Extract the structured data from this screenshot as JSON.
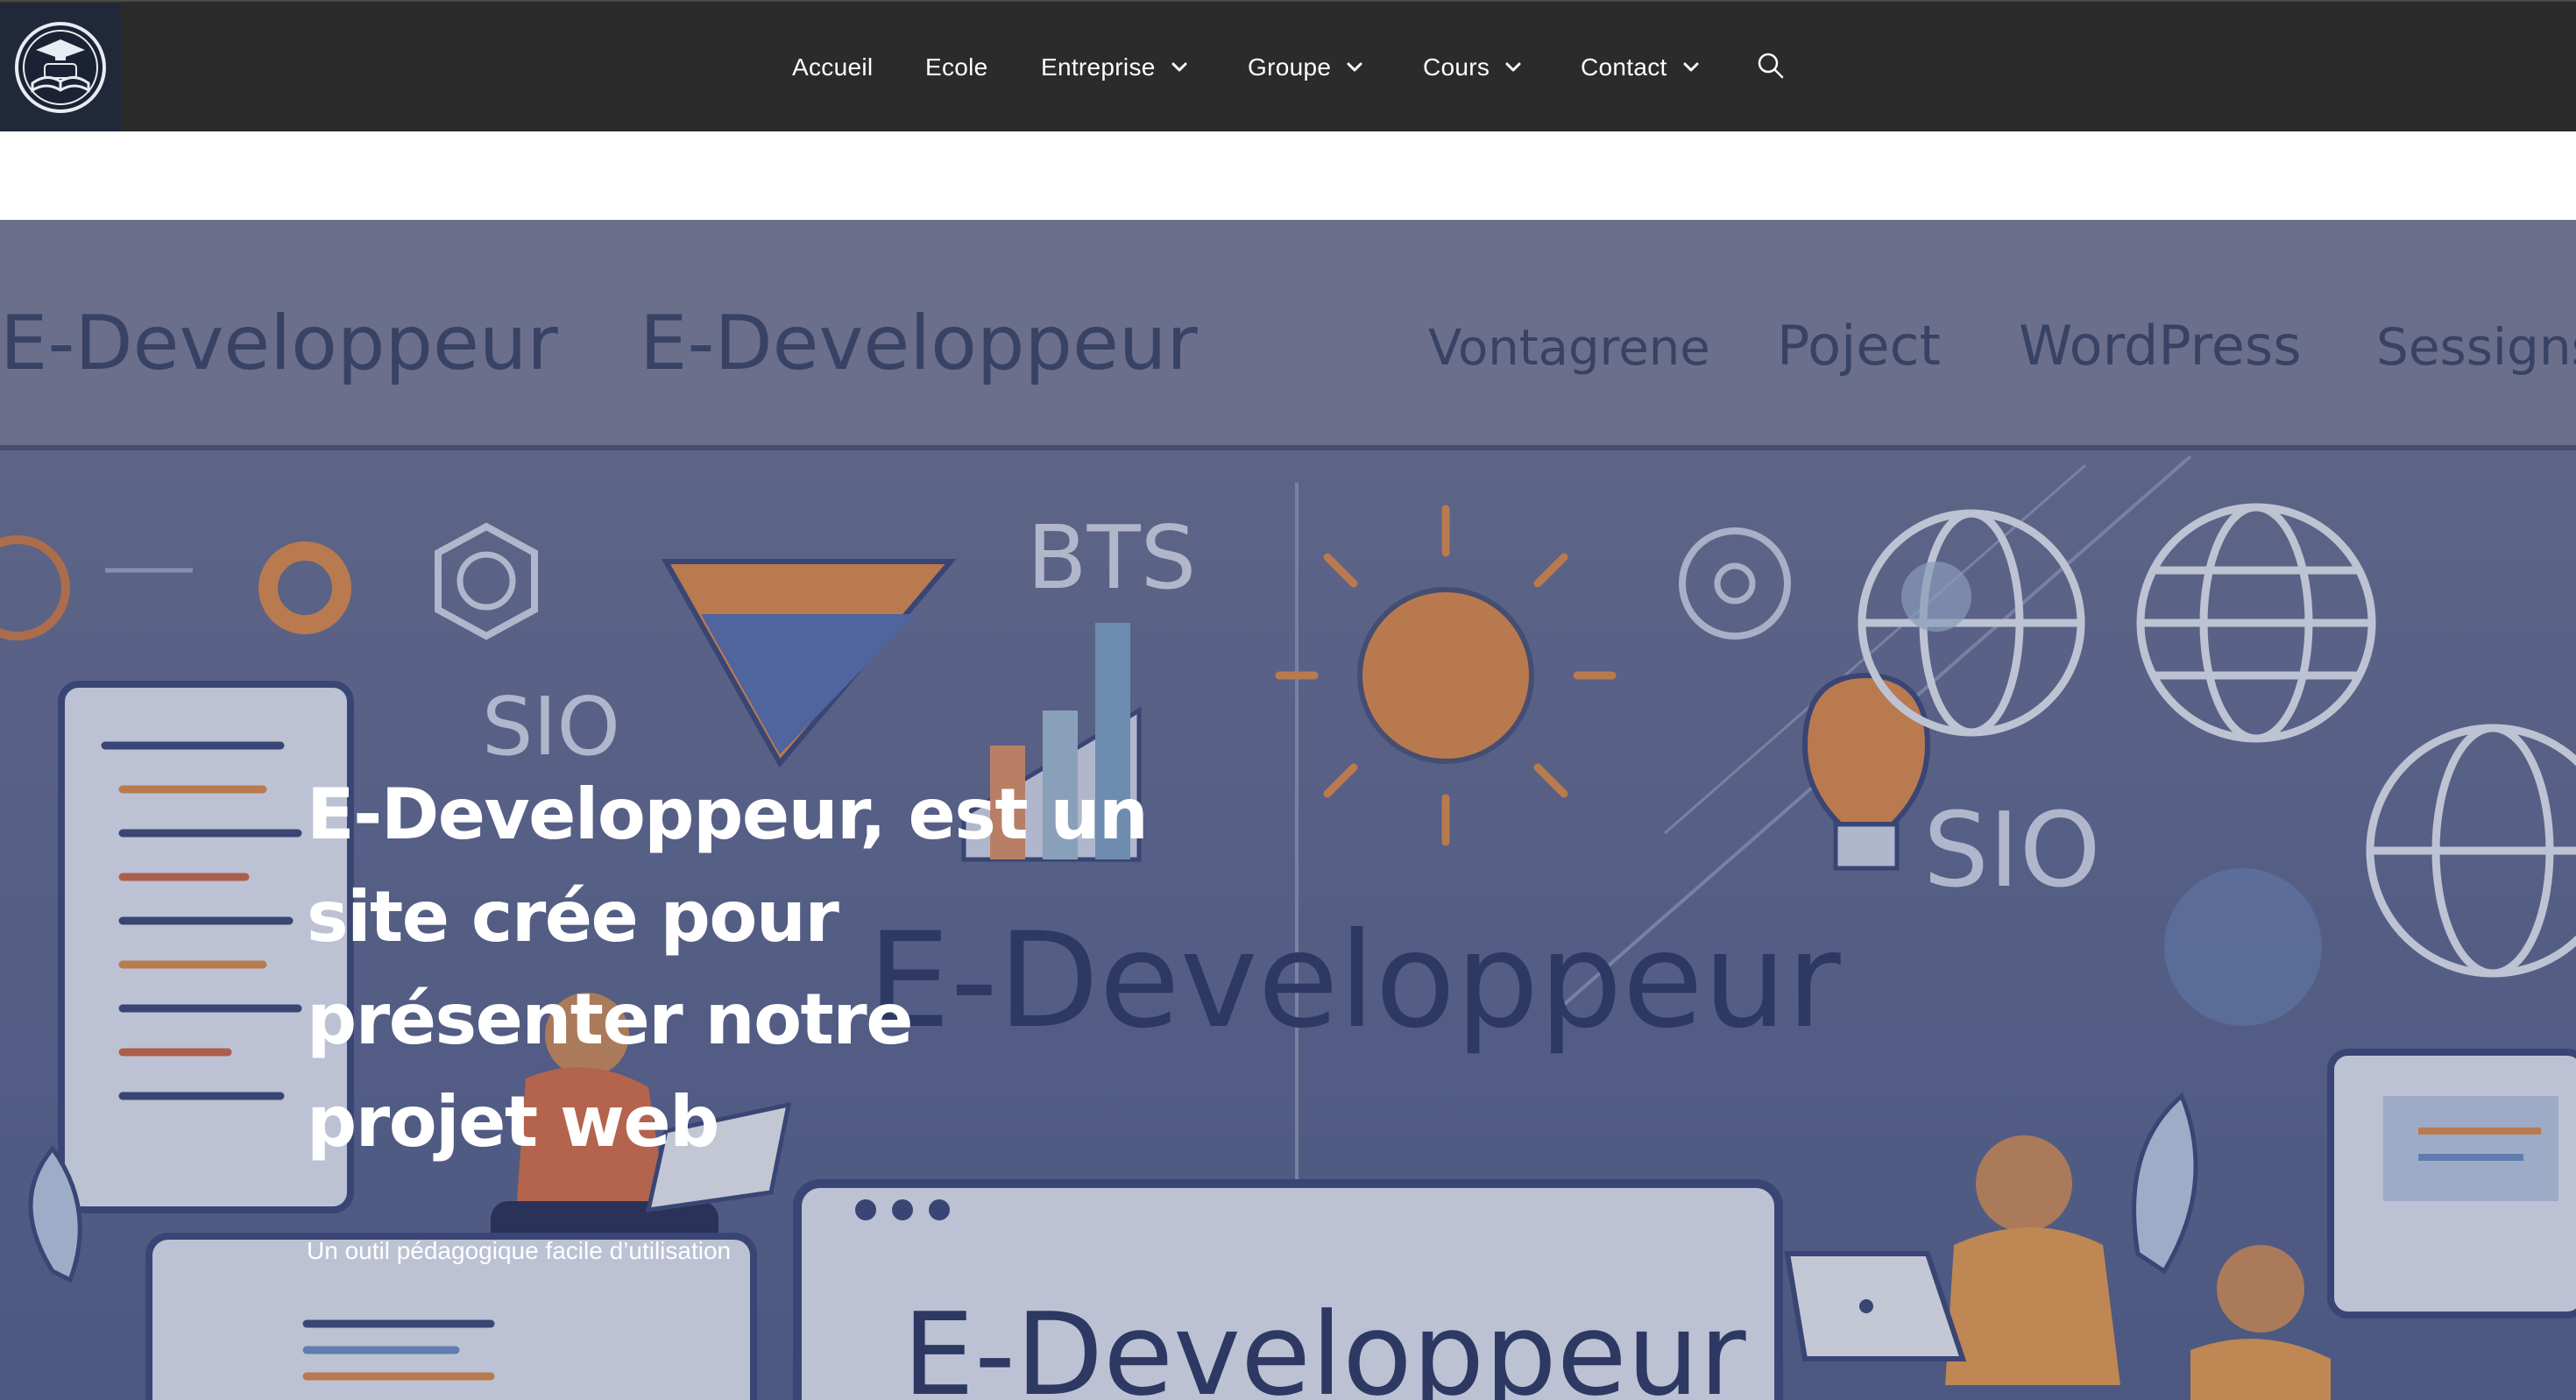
{
  "header": {
    "logo_icon": "graduation-book-logo-icon",
    "nav": [
      {
        "label": "Accueil",
        "dropdown": false
      },
      {
        "label": "Ecole",
        "dropdown": false
      },
      {
        "label": "Entreprise",
        "dropdown": true
      },
      {
        "label": "Groupe",
        "dropdown": true
      },
      {
        "label": "Cours",
        "dropdown": true
      },
      {
        "label": "Contact",
        "dropdown": true
      }
    ],
    "search_icon": "search-icon",
    "colors": {
      "bar": "#2b2b2b",
      "text": "#ffffff"
    }
  },
  "hero": {
    "title": "E-Developpeur, est un site crée pour présenter notre projet web",
    "subtitle": "Un outil pédagogique facile d’utilisation",
    "background_texts": {
      "top_left_1": "E-Developpeur",
      "top_left_2": "E-Developpeur",
      "top_right_1": "Vontagrene",
      "top_right_2": "Poject",
      "top_right_3": "WordPress",
      "top_right_4": "Sessigns",
      "bts": "BTS",
      "sio_1": "SIO",
      "sio_2": "SIO",
      "center_brand": "E-Developpeur",
      "bottom_brand": "E-Developpeur"
    },
    "colors": {
      "tint": "#5a6488",
      "orange": "#d98a4e",
      "outline": "#dfe3ee"
    }
  }
}
